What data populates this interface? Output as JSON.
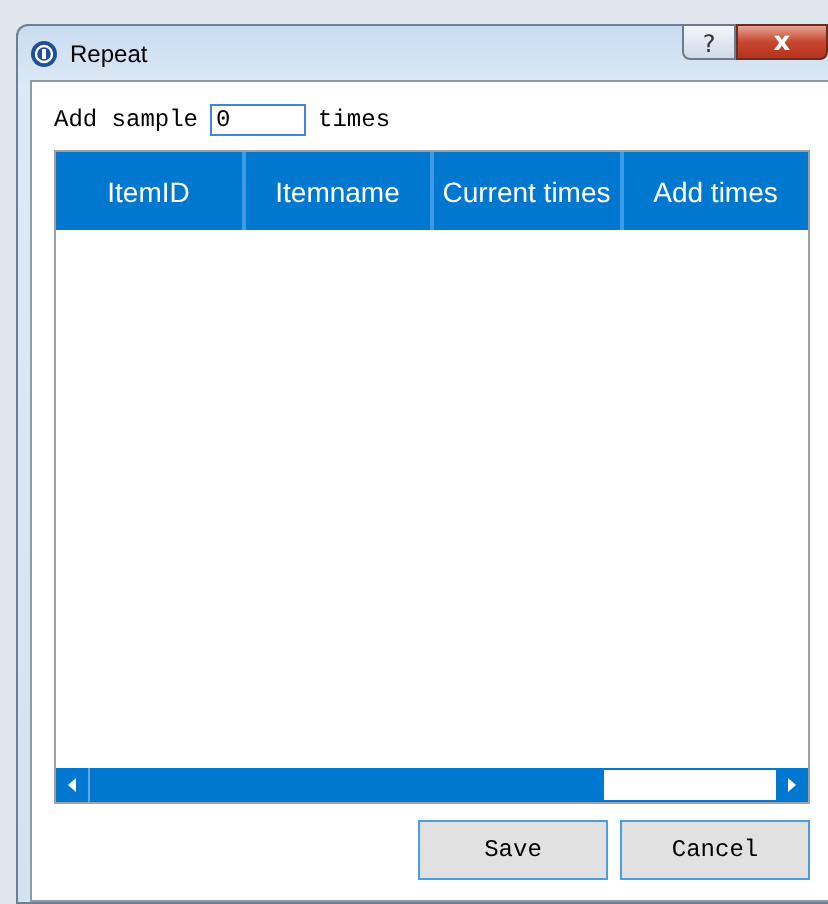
{
  "window": {
    "title": "Repeat",
    "help": "?",
    "close": "x"
  },
  "sample": {
    "label": "Add sample",
    "value": "0",
    "suffix": "times"
  },
  "table": {
    "columns": [
      "ItemID",
      "Itemname",
      "Current times",
      "Add times"
    ]
  },
  "buttons": [
    "Save",
    "Cancel"
  ]
}
